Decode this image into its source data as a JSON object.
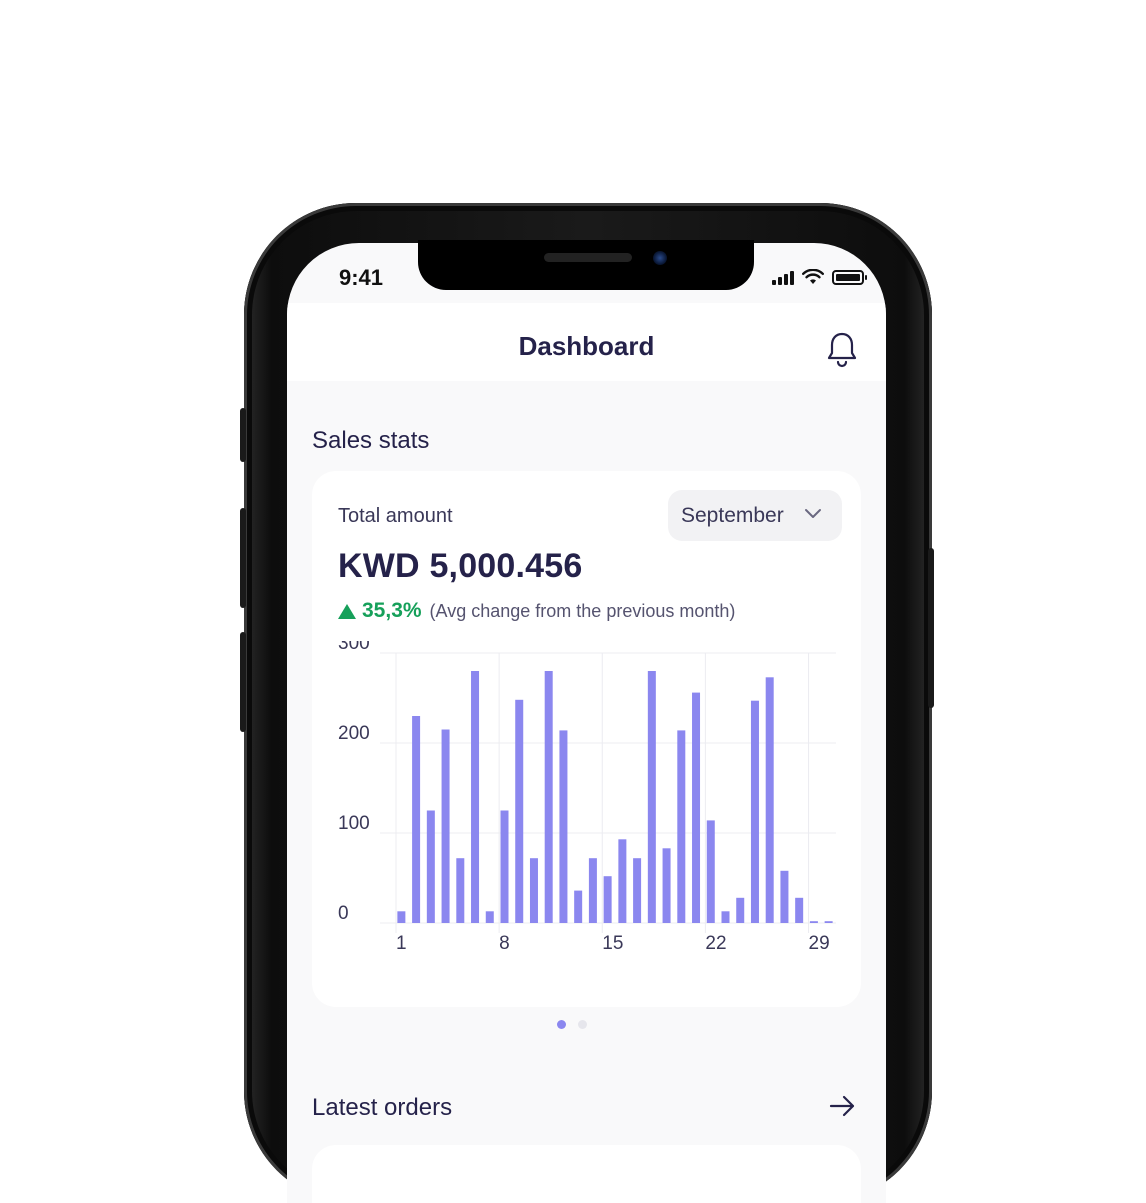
{
  "status_bar": {
    "time": "9:41",
    "icons": [
      "signal-icon",
      "wifi-icon",
      "battery-icon"
    ]
  },
  "header": {
    "title": "Dashboard",
    "bell_icon": "bell-icon"
  },
  "sales": {
    "section_title": "Sales stats",
    "card_label": "Total amount",
    "month": "September",
    "amount": "KWD 5,000.456",
    "change_pct": "35,3%",
    "change_note": "(Avg change from the previous month)"
  },
  "orders": {
    "section_title": "Latest orders"
  },
  "colors": {
    "bar": "#8b87ef",
    "accent": "#8b87ef",
    "positive": "#16a05a",
    "text": "#25224a"
  },
  "chart_data": {
    "type": "bar",
    "x": [
      1,
      2,
      3,
      4,
      5,
      6,
      7,
      8,
      9,
      10,
      11,
      12,
      13,
      14,
      15,
      16,
      17,
      18,
      19,
      20,
      21,
      22,
      23,
      24,
      25,
      26,
      27,
      28,
      29,
      30
    ],
    "values": [
      13,
      230,
      125,
      215,
      72,
      280,
      13,
      125,
      248,
      72,
      280,
      214,
      36,
      72,
      52,
      93,
      72,
      280,
      83,
      214,
      256,
      114,
      13,
      28,
      247,
      273,
      58,
      28,
      2,
      2
    ],
    "y_ticks": [
      0,
      100,
      200,
      300
    ],
    "x_ticks": [
      1,
      8,
      15,
      22,
      29
    ],
    "ylim": [
      0,
      300
    ],
    "grid": true
  },
  "pager": {
    "count": 2,
    "active": 0
  }
}
